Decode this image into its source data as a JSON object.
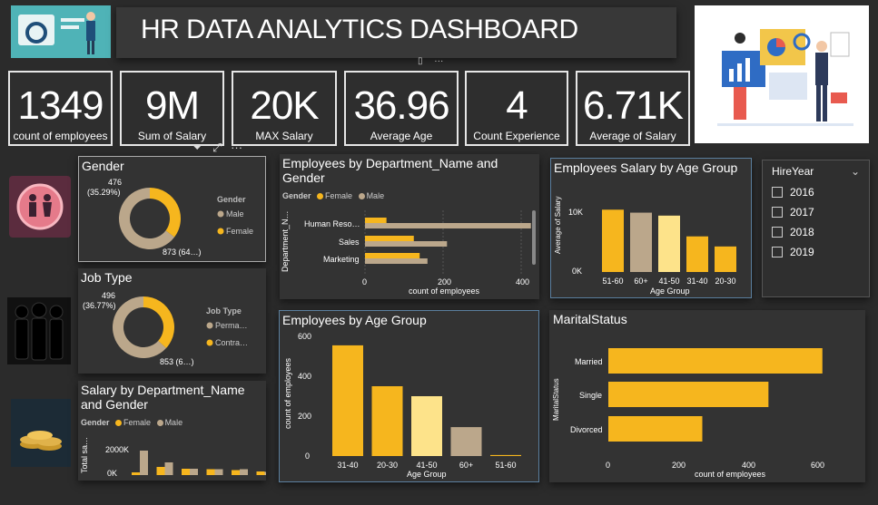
{
  "header": {
    "title": "HR DATA ANALYTICS DASHBOARD"
  },
  "kpis": [
    {
      "value": "1349",
      "label": "count of employees"
    },
    {
      "value": "9M",
      "label": "Sum of Salary"
    },
    {
      "value": "20K",
      "label": "MAX Salary"
    },
    {
      "value": "36.96",
      "label": "Average Age"
    },
    {
      "value": "4",
      "label": "Count Experience"
    },
    {
      "value": "6.71K",
      "label": "Average of Salary"
    }
  ],
  "colors": {
    "female": "#f6b61e",
    "male": "#bba78b",
    "light": "#fde38a",
    "bg": "#2b2b2b",
    "panel": "#333333"
  },
  "gender": {
    "title": "Gender",
    "legend_title": "Gender",
    "legend": [
      "Male",
      "Female"
    ],
    "female_label": "476",
    "female_pct": "(35.29%)",
    "male_label": "873 (64…)",
    "chart_data": {
      "type": "pie",
      "labels": [
        "Male",
        "Female"
      ],
      "values": [
        873,
        476
      ]
    }
  },
  "jobtype": {
    "title": "Job Type",
    "legend_title": "Job Type",
    "legend": [
      "Perma…",
      "Contra…"
    ],
    "small_label": "496",
    "small_pct": "(36.77%)",
    "big_label": "853 (6…)",
    "chart_data": {
      "type": "pie",
      "labels": [
        "Permanent",
        "Contract"
      ],
      "values": [
        853,
        496
      ]
    }
  },
  "salary_dept": {
    "title": "Salary by Department_Name and Gender",
    "legend_title": "Gender",
    "legend": [
      "Female",
      "Male"
    ],
    "yaxis": "Total sa…",
    "ticks": [
      "2000K",
      "0K"
    ],
    "chart_data": {
      "type": "bar",
      "series": [
        {
          "name": "Female",
          "values": [
            300,
            900,
            700,
            650,
            550,
            400
          ]
        },
        {
          "name": "Male",
          "values": [
            2700,
            1400,
            700,
            650,
            650,
            350
          ]
        }
      ],
      "ylim": [
        0,
        3000
      ]
    }
  },
  "emp_dept": {
    "title": "Employees by Department_Name and Gender",
    "legend_title": "Gender",
    "legend": [
      "Female",
      "Male"
    ],
    "yaxis": "Department_N…",
    "xlabel": "count of employees",
    "categories": [
      "Human Reso…",
      "Sales",
      "Marketing"
    ],
    "xticks": [
      "0",
      "200",
      "400"
    ],
    "chart_data": {
      "type": "bar",
      "categories": [
        "Human Reso…",
        "Sales",
        "Marketing"
      ],
      "series": [
        {
          "name": "Female",
          "values": [
            55,
            125,
            140
          ]
        },
        {
          "name": "Male",
          "values": [
            425,
            210,
            160
          ]
        }
      ],
      "xlim": [
        0,
        440
      ]
    }
  },
  "salary_age": {
    "title": "Employees Salary by Age Group",
    "ylabel": "Average of Salary",
    "xlabel": "Age Group",
    "yticks": [
      "10K",
      "0K"
    ],
    "categories": [
      "51-60",
      "60+",
      "41-50",
      "31-40",
      "20-30"
    ],
    "chart_data": {
      "type": "bar",
      "categories": [
        "51-60",
        "60+",
        "41-50",
        "31-40",
        "20-30"
      ],
      "values": [
        10.5,
        10,
        9.5,
        6,
        4.3
      ],
      "ylim": [
        0,
        12
      ]
    }
  },
  "hireyear": {
    "title": "HireYear",
    "items": [
      "2016",
      "2017",
      "2018",
      "2019"
    ]
  },
  "emp_age": {
    "title": "Employees by Age Group",
    "ylabel": "count of employees",
    "xlabel": "Age Group",
    "yticks": [
      "600",
      "400",
      "200",
      "0"
    ],
    "categories": [
      "31-40",
      "20-30",
      "41-50",
      "60+",
      "51-60"
    ],
    "chart_data": {
      "type": "bar",
      "categories": [
        "31-40",
        "20-30",
        "41-50",
        "60+",
        "51-60"
      ],
      "values": [
        555,
        350,
        300,
        145,
        5
      ],
      "ylim": [
        0,
        600
      ]
    }
  },
  "marital": {
    "title": "MaritalStatus",
    "ylabel": "MaritalStatus",
    "xlabel": "count of employees",
    "categories": [
      "Married",
      "Single",
      "Divorced"
    ],
    "xticks": [
      "0",
      "200",
      "400",
      "600"
    ],
    "chart_data": {
      "type": "bar",
      "categories": [
        "Married",
        "Single",
        "Divorced"
      ],
      "values": [
        615,
        460,
        270
      ],
      "xlim": [
        0,
        650
      ]
    }
  }
}
